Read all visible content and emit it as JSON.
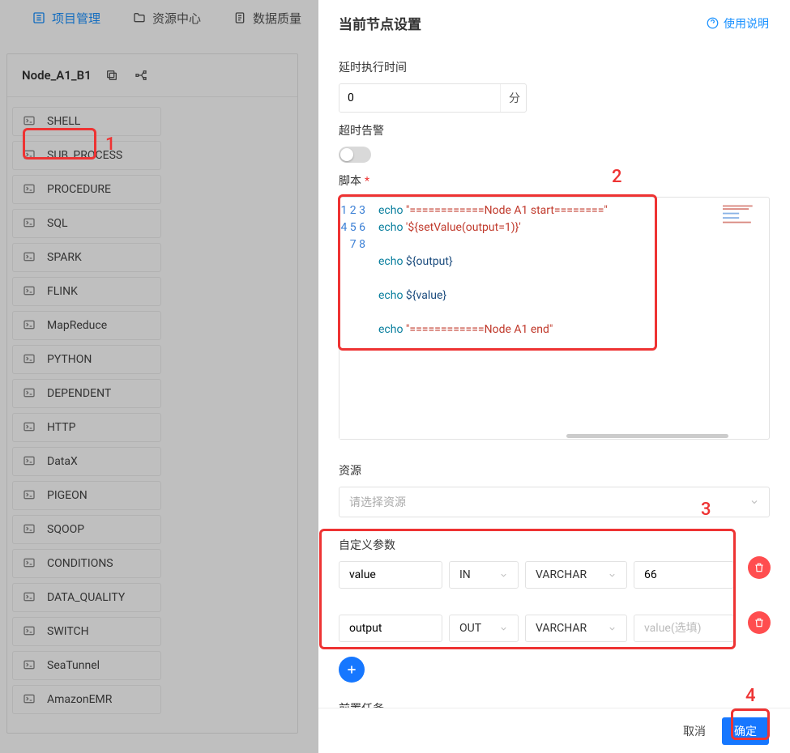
{
  "nav": {
    "project": "项目管理",
    "resource": "资源中心",
    "dataquality": "数据质量"
  },
  "node": {
    "name": "Node_A1_B1"
  },
  "tasks": [
    "SHELL",
    "SUB_PROCESS",
    "PROCEDURE",
    "SQL",
    "SPARK",
    "FLINK",
    "MapReduce",
    "PYTHON",
    "DEPENDENT",
    "HTTP",
    "DataX",
    "PIGEON",
    "SQOOP",
    "CONDITIONS",
    "DATA_QUALITY",
    "SWITCH",
    "SeaTunnel",
    "AmazonEMR"
  ],
  "drawer": {
    "title": "当前节点设置",
    "help": "使用说明",
    "delayLabel": "延时执行时间",
    "delayValue": "0",
    "delayUnit": "分",
    "timeoutLabel": "超时告警",
    "timeoutOn": false,
    "scriptLabel": "脚本",
    "script": {
      "lines": [
        {
          "n": "1",
          "segs": [
            {
              "t": "echo ",
              "c": "kw"
            },
            {
              "t": "\"============Node A1 start========\"",
              "c": "str"
            }
          ]
        },
        {
          "n": "2",
          "segs": [
            {
              "t": "echo ",
              "c": "kw"
            },
            {
              "t": "'${setValue(output=1)}'",
              "c": "str"
            }
          ]
        },
        {
          "n": "3",
          "segs": []
        },
        {
          "n": "4",
          "segs": [
            {
              "t": "echo ",
              "c": "kw"
            },
            {
              "t": "${",
              "c": "var"
            },
            {
              "t": "output",
              "c": "var"
            },
            {
              "t": "}",
              "c": "var"
            }
          ]
        },
        {
          "n": "5",
          "segs": []
        },
        {
          "n": "6",
          "segs": [
            {
              "t": "echo ",
              "c": "kw"
            },
            {
              "t": "${",
              "c": "var"
            },
            {
              "t": "value",
              "c": "var"
            },
            {
              "t": "}",
              "c": "var"
            }
          ]
        },
        {
          "n": "7",
          "segs": []
        },
        {
          "n": "8",
          "segs": [
            {
              "t": "echo ",
              "c": "kw"
            },
            {
              "t": "\"============Node A1 end\"",
              "c": "str"
            }
          ]
        }
      ]
    },
    "resourceLabel": "资源",
    "resourcePlaceholder": "请选择资源",
    "paramsLabel": "自定义参数",
    "params": [
      {
        "name": "value",
        "dir": "IN",
        "type": "VARCHAR",
        "val": "66",
        "valPlaceholder": ""
      },
      {
        "name": "output",
        "dir": "OUT",
        "type": "VARCHAR",
        "val": "",
        "valPlaceholder": "value(选填)"
      }
    ],
    "preTaskLabel": "前置任务",
    "cancel": "取消",
    "confirm": "确定"
  },
  "annotations": {
    "a1": "1",
    "a2": "2",
    "a3": "3",
    "a4": "4"
  }
}
